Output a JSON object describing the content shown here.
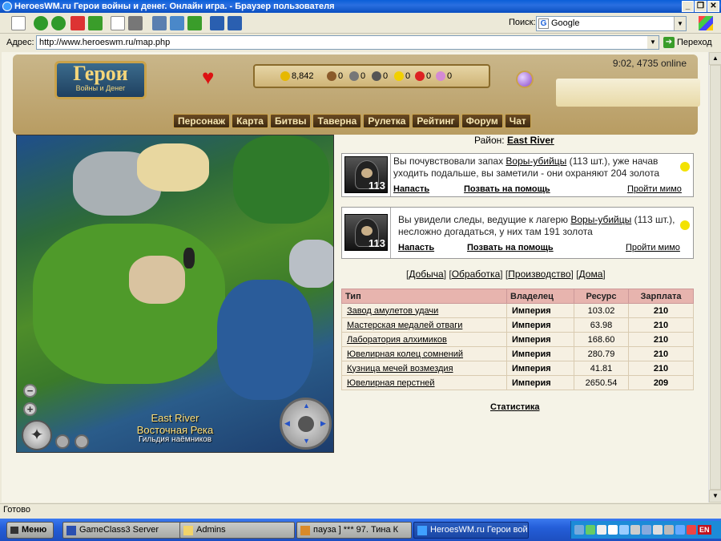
{
  "window": {
    "title": "HeroesWM.ru Герои войны и денег. Онлайн игра. - Браузер пользователя"
  },
  "toolbar": {
    "search_label": "Поиск:",
    "search_value": "Google",
    "address_label": "Адрес:",
    "address_value": "http://www.heroeswm.ru/map.php",
    "go_label": "Переход"
  },
  "header": {
    "logo_big": "Герои",
    "logo_small": "Войны и Денег",
    "online": "9:02, 4735 online",
    "resources": [
      {
        "icon": "gold-icon",
        "value": "8,842"
      },
      {
        "icon": "wood-icon",
        "value": "0"
      },
      {
        "icon": "ore-icon",
        "value": "0"
      },
      {
        "icon": "mercury-icon",
        "value": "0"
      },
      {
        "icon": "sulfur-icon",
        "value": "0"
      },
      {
        "icon": "crystal-icon",
        "value": "0"
      },
      {
        "icon": "gems-icon",
        "value": "0"
      }
    ],
    "nav": [
      "Персонаж",
      "Карта",
      "Битвы",
      "Таверна",
      "Рулетка",
      "Рейтинг",
      "Форум",
      "Чат"
    ]
  },
  "map": {
    "label_en": "East River",
    "label_ru": "Восточная Река",
    "guild": "Гильдия наёмников"
  },
  "district": {
    "label": "Район:",
    "name": "East River"
  },
  "encounters": [
    {
      "count": "113",
      "text_before": "Вы почувствовали запах ",
      "creature": "Воры-убийцы",
      "text_after": " (113 шт.), уже начав уходить подальше, вы заметили - они охраняют 204 золота",
      "attack": "Напасть",
      "help": "Позвать на помощь",
      "pass": "Пройти мимо"
    },
    {
      "count": "113",
      "text_before": "Вы увидели следы, ведущие к лагерю ",
      "creature": "Воры-убийцы",
      "text_after": " (113 шт.), несложно догадаться, у них там 191 золота",
      "attack": "Напасть",
      "help": "Позвать на помощь",
      "pass": "Пройти мимо"
    }
  ],
  "tabs": [
    "Добыча",
    "Обработка",
    "Производство",
    "Дома"
  ],
  "table": {
    "headers": [
      "Тип",
      "Владелец",
      "Ресурс",
      "Зарплата"
    ],
    "rows": [
      {
        "type": "Завод амулетов удачи",
        "owner": "Империя",
        "resource": "103.02",
        "salary": "210"
      },
      {
        "type": "Мастерская медалей отваги",
        "owner": "Империя",
        "resource": "63.98",
        "salary": "210"
      },
      {
        "type": "Лаборатория алхимиков",
        "owner": "Империя",
        "resource": "168.60",
        "salary": "210"
      },
      {
        "type": "Ювелирная колец сомнений",
        "owner": "Империя",
        "resource": "280.79",
        "salary": "210"
      },
      {
        "type": "Кузница мечей возмездия",
        "owner": "Империя",
        "resource": "41.81",
        "salary": "210"
      },
      {
        "type": "Ювелирная перстней",
        "owner": "Империя",
        "resource": "2650.54",
        "salary": "209"
      }
    ]
  },
  "stats_link": "Статистика",
  "status": "Готово",
  "taskbar": {
    "start": "Меню",
    "tasks": [
      "GameClass3 Server",
      "Admins",
      "пауза ] *** 97. Тина К",
      "HeroesWM.ru Герои вой"
    ],
    "lang": "EN"
  }
}
